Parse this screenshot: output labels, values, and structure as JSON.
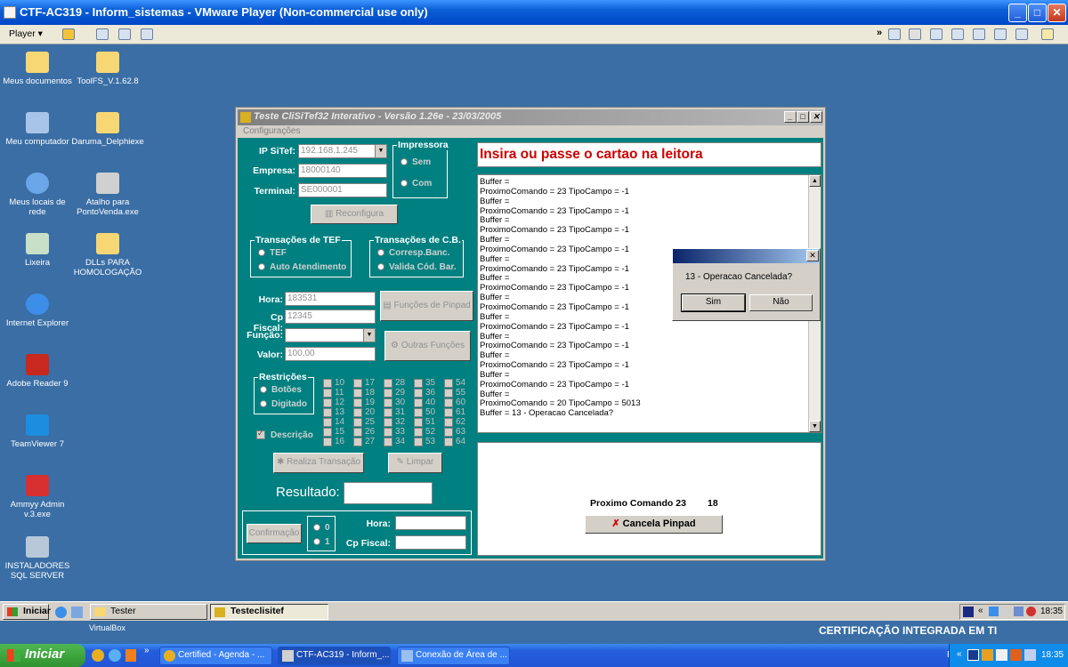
{
  "host": {
    "title": "CTF-AC319 - Inform_sistemas - VMware Player (Non-commercial use only)",
    "player_menu": "Player"
  },
  "desktop_icons": [
    {
      "label": "Meus documentos",
      "icon": "folder-documents-icon"
    },
    {
      "label": "ToolFS_V.1.62.8",
      "icon": "folder-icon"
    },
    {
      "label": "Meu computador",
      "icon": "computer-icon"
    },
    {
      "label": "Daruma_Delphiexe",
      "icon": "folder-icon"
    },
    {
      "label": "Meus locais de rede",
      "icon": "network-icon"
    },
    {
      "label": "Atalho para PontoVenda.exe",
      "icon": "shortcut-icon"
    },
    {
      "label": "Lixeira",
      "icon": "recycle-bin-icon"
    },
    {
      "label": "DLLs PARA HOMOLOGAÇÃO",
      "icon": "folder-icon"
    },
    {
      "label": "Internet Explorer",
      "icon": "ie-icon"
    },
    {
      "label": "Adobe Reader 9",
      "icon": "pdf-icon"
    },
    {
      "label": "TeamViewer 7",
      "icon": "teamviewer-icon"
    },
    {
      "label": "Ammyy Admin v.3.exe",
      "icon": "ammyy-icon"
    },
    {
      "label": "INSTALADORES SQL SERVER",
      "icon": "installer-icon"
    }
  ],
  "app": {
    "title": "Teste CliSiTef32 Interativo - Versão 1.26e - 23/03/2005",
    "menu": "Configurações",
    "ip_label": "IP SiTef:",
    "ip_value": "192.168.1.245",
    "empresa_label": "Empresa:",
    "empresa_value": "18000140",
    "terminal_label": "Terminal:",
    "terminal_value": "SE000001",
    "reconfigura": "Reconfigura",
    "impressora": {
      "caption": "Impressora",
      "sem": "Sem",
      "com": "Com"
    },
    "tef_group": {
      "caption": "Transações de TEF",
      "tef": "TEF",
      "auto": "Auto Atendimento"
    },
    "cb_group": {
      "caption": "Transações de C.B.",
      "corresp": "Corresp.Banc.",
      "valida": "Valida Cód. Bar."
    },
    "hora_label": "Hora:",
    "hora_value": "183531",
    "cpfiscal_label": "Cp Fiscal:",
    "cpfiscal_value": "12345",
    "funcao_label": "Função:",
    "valor_label": "Valor:",
    "valor_value": "100,00",
    "funcoes_pinpad": "Funções de Pinpad",
    "outras_funcoes": "Outras Funções",
    "restricoes": {
      "caption": "Restrições",
      "botoes": "Botões",
      "digitado": "Digitado"
    },
    "numbers": [
      [
        "10",
        "11",
        "12",
        "13",
        "14",
        "15",
        "16"
      ],
      [
        "17",
        "18",
        "19",
        "20",
        "25",
        "26",
        "27"
      ],
      [
        "28",
        "29",
        "30",
        "31",
        "32",
        "33",
        "34"
      ],
      [
        "35",
        "36",
        "40",
        "50",
        "51",
        "52",
        "53"
      ],
      [
        "54",
        "55",
        "60",
        "61",
        "62",
        "63",
        "64"
      ]
    ],
    "descricao": "Descrição",
    "realiza": "Realiza Transação",
    "limpar": "Limpar",
    "resultado_label": "Resultado:",
    "confirmacao": "Confirmação",
    "opt0": "0",
    "opt1": "1",
    "hora2_label": "Hora:",
    "cpfiscal2_label": "Cp Fiscal:",
    "message": "Insira ou passe o cartao na leitora",
    "log": [
      "Buffer =",
      "ProximoComando = 23 TipoCampo = -1",
      "Buffer =",
      "ProximoComando = 23 TipoCampo = -1",
      "Buffer =",
      "ProximoComando = 23 TipoCampo = -1",
      "Buffer =",
      "ProximoComando = 23 TipoCampo = -1",
      "Buffer =",
      "ProximoComando = 23 TipoCampo = -1",
      "Buffer =",
      "ProximoComando = 23 TipoCampo = -1",
      "Buffer =",
      "ProximoComando = 23 TipoCampo = -1",
      "Buffer =",
      "ProximoComando = 23 TipoCampo = -1",
      "Buffer =",
      "ProximoComando = 23 TipoCampo = -1",
      "Buffer =",
      "ProximoComando = 23 TipoCampo = -1",
      "Buffer =",
      "ProximoComando = 23 TipoCampo = -1",
      "Buffer =",
      "ProximoComando = 20 TipoCampo = 5013",
      "Buffer = 13 - Operacao Cancelada?"
    ],
    "proximo_label": "Proximo Comando 23",
    "proximo_num": "18",
    "cancela": "Cancela Pinpad"
  },
  "dialog": {
    "message": "13 - Operacao Cancelada?",
    "sim": "Sim",
    "nao": "Não"
  },
  "vm_taskbar": {
    "start": "Iniciar",
    "tester": "Tester",
    "app": "Testeclisitef",
    "time": "18:35"
  },
  "host_strip": {
    "virtualbox": "VirtualBox",
    "banner": "CERTIFICAÇÃO INTEGRADA EM TI"
  },
  "xp_taskbar": {
    "start": "Iniciar",
    "items": [
      "Certified - Agenda - ...",
      "CTF-AC319 - Inform_...",
      "Conexão de Área de ..."
    ],
    "lang": "PT",
    "time": "18:35"
  },
  "colors": {
    "app_bg": "#008080",
    "message_red": "#cc0000",
    "xp_blue": "#245edb"
  }
}
